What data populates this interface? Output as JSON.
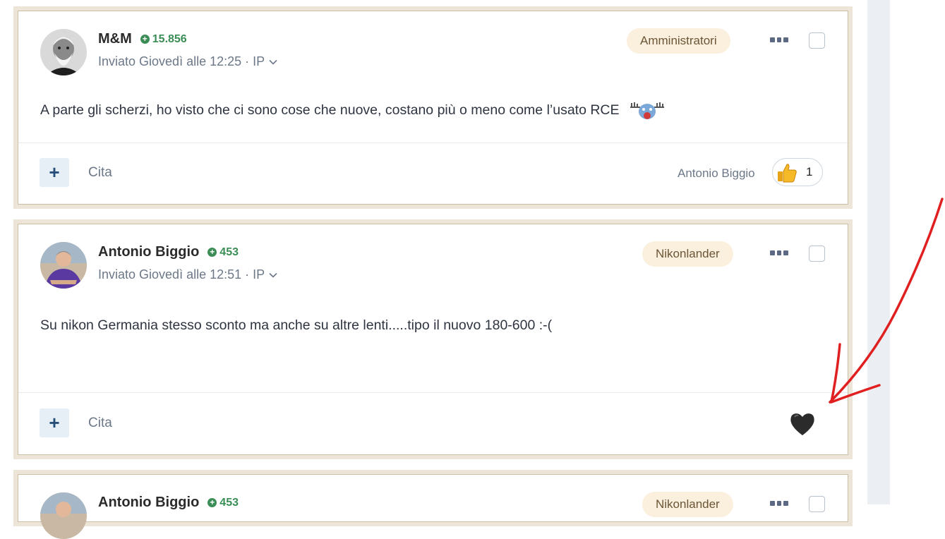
{
  "posts": [
    {
      "author": "M&M",
      "reputation": "15.856",
      "meta": "Inviato Giovedì alle 12:25 · IP",
      "role_badge": "Amministratori",
      "content": "A parte gli scherzi, ho visto che ci sono cose che nuove, costano più o meno come l’usato RCE",
      "quote_label": "Cita",
      "reacted_by": "Antonio Biggio",
      "reaction_count": "1",
      "reaction_icon": "thumbs-up-icon"
    },
    {
      "author": "Antonio Biggio",
      "reputation": "453",
      "meta": "Inviato Giovedì alle 12:51 · IP",
      "role_badge": "Nikonlander",
      "content": "Su nikon Germania stesso sconto ma anche su altre lenti.....tipo il nuovo 180-600 :-(",
      "quote_label": "Cita",
      "reaction_icon": "black-heart-icon"
    },
    {
      "author": "Antonio Biggio",
      "reputation": "453",
      "role_badge": "Nikonlander"
    }
  ],
  "colors": {
    "post_frame": "#ede6d8",
    "reputation_green": "#3a8d55",
    "badge_bg": "#fbf0dd",
    "annotation_red": "#e02020"
  }
}
